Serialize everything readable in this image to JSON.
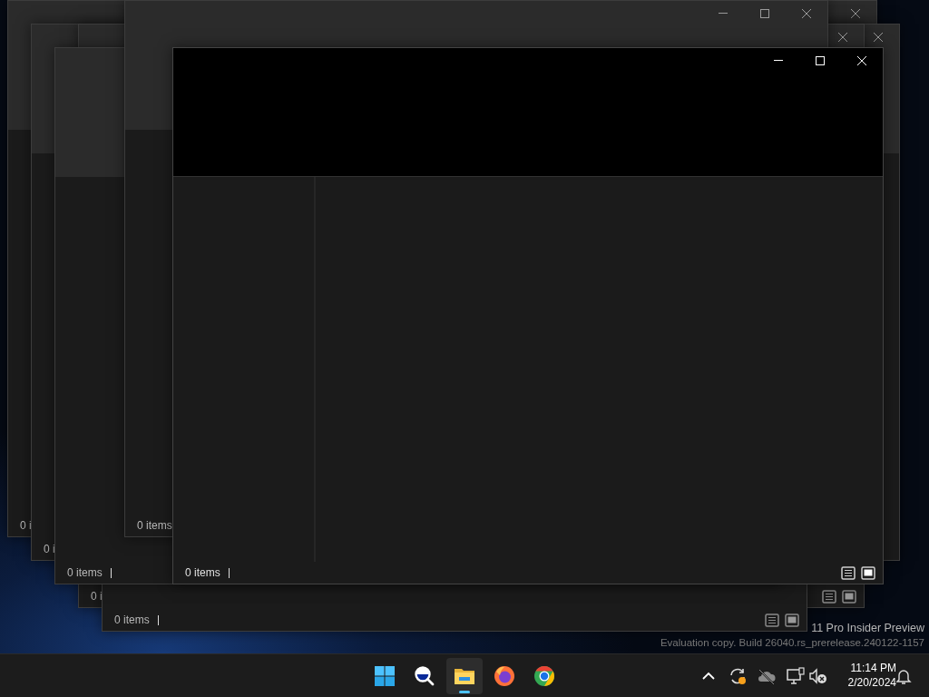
{
  "windows": [
    {
      "kind": "inactive",
      "status": "0 i",
      "caption_buttons": [
        {
          "kind": "close"
        }
      ]
    },
    {
      "kind": "inactive",
      "status": "0 i",
      "caption_buttons": [
        {
          "kind": "close"
        }
      ]
    },
    {
      "kind": "inactive",
      "status": "0 i",
      "caption_buttons": [
        {
          "kind": "close"
        }
      ],
      "view_buttons": [
        {
          "kind": "details",
          "selected": false
        },
        {
          "kind": "tiles",
          "selected": true
        }
      ]
    },
    {
      "kind": "inactive",
      "status": "0 items",
      "view_buttons": [
        {
          "kind": "details",
          "selected": false
        },
        {
          "kind": "tiles",
          "selected": true
        }
      ]
    },
    {
      "kind": "inactive",
      "status": "0 items"
    },
    {
      "kind": "inactive",
      "status": "0 items",
      "caption_buttons": [
        {
          "kind": "minimize"
        },
        {
          "kind": "maximize"
        },
        {
          "kind": "close"
        }
      ]
    },
    {
      "kind": "active",
      "status": "0 items",
      "caption_buttons": [
        {
          "kind": "minimize"
        },
        {
          "kind": "maximize"
        },
        {
          "kind": "close"
        }
      ],
      "view_buttons": [
        {
          "kind": "details",
          "selected": false
        },
        {
          "kind": "tiles",
          "selected": true
        }
      ]
    }
  ],
  "desktop_watermark": {
    "line_1": "11 Pro Insider Preview",
    "line_2": "Evaluation copy. Build 26040.rs_prerelease.240122-1157"
  },
  "taskbar": {
    "items": [
      {
        "kind": "start",
        "selected": false
      },
      {
        "kind": "search",
        "selected": false
      },
      {
        "kind": "file_explorer",
        "selected": true
      },
      {
        "kind": "firefox",
        "selected": false
      },
      {
        "kind": "chrome",
        "selected": false
      }
    ],
    "tray": [
      {
        "kind": "chevron"
      },
      {
        "kind": "sync"
      },
      {
        "kind": "cloud"
      },
      {
        "kind": "network"
      },
      {
        "kind": "speaker_muted"
      }
    ],
    "time": "11:14 PM",
    "date": "2/20/2024"
  }
}
